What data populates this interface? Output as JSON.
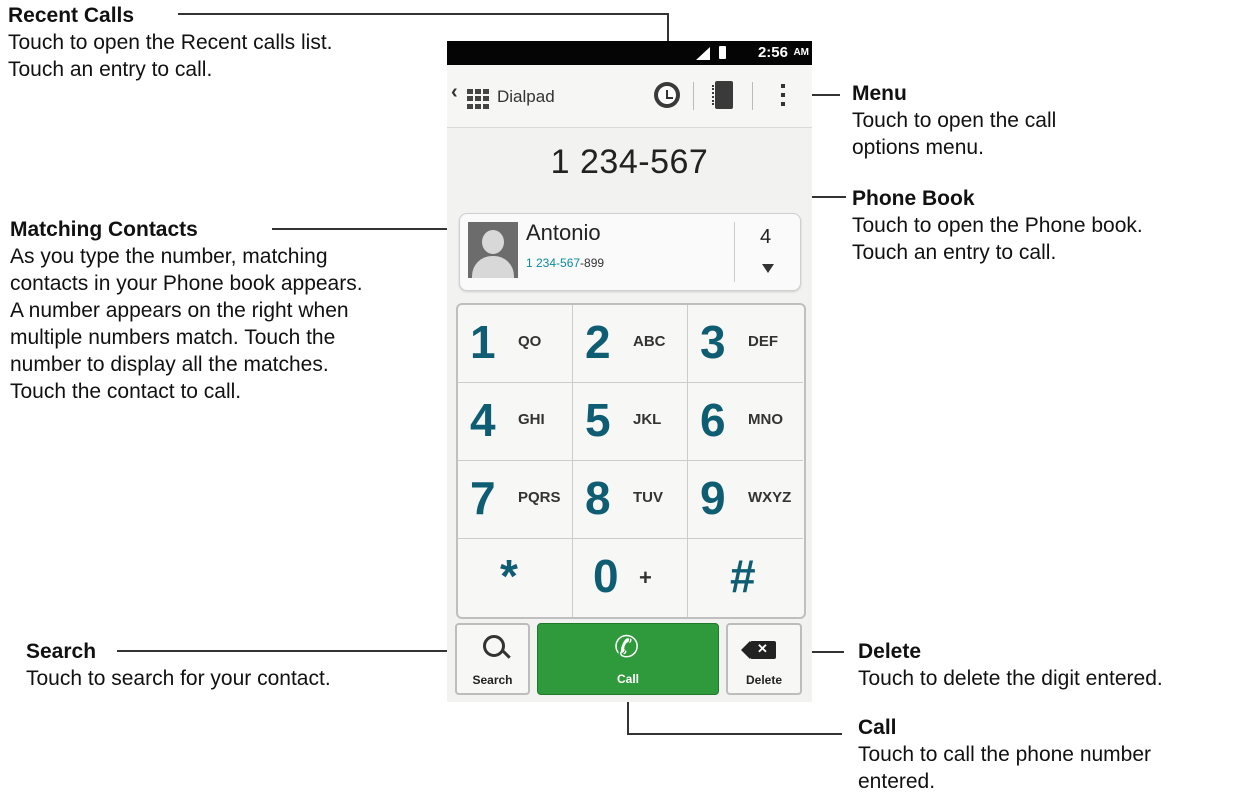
{
  "callouts": {
    "recent_calls": {
      "title": "Recent Calls",
      "desc": "Touch to open the Recent calls list.\nTouch an entry to call."
    },
    "menu": {
      "title": "Menu",
      "desc": "Touch to open the call\noptions menu."
    },
    "phone_book": {
      "title": "Phone Book",
      "desc": "Touch to open the Phone book.\nTouch an entry to call."
    },
    "matching_contacts": {
      "title": "Matching Contacts",
      "desc": "As you type the number, matching\ncontacts in your Phone book appears.\nA number appears on the right when\nmultiple numbers match. Touch the\nnumber to display all the matches.\nTouch the contact to call."
    },
    "search": {
      "title": "Search",
      "desc": "Touch to search for your contact."
    },
    "delete": {
      "title": "Delete",
      "desc": "Touch to delete the digit entered."
    },
    "call": {
      "title": "Call",
      "desc": "Touch to call the phone number\nentered."
    }
  },
  "phone": {
    "status": {
      "time": "2:56",
      "ampm": "AM",
      "icons": [
        "signal-icon",
        "battery-icon"
      ]
    },
    "action_bar": {
      "title": "Dialpad",
      "icons": [
        "back-icon",
        "grid-icon",
        "recent-calls-icon",
        "phone-book-icon",
        "menu-icon"
      ]
    },
    "number": "1 234-567",
    "contact": {
      "name": "Antonio",
      "number_match": "1 234-567",
      "number_rest": "-899",
      "match_count": "4"
    },
    "keys": [
      {
        "digit": "1",
        "letters": "QO"
      },
      {
        "digit": "2",
        "letters": "ABC"
      },
      {
        "digit": "3",
        "letters": "DEF"
      },
      {
        "digit": "4",
        "letters": "GHI"
      },
      {
        "digit": "5",
        "letters": "JKL"
      },
      {
        "digit": "6",
        "letters": "MNO"
      },
      {
        "digit": "7",
        "letters": "PQRS"
      },
      {
        "digit": "8",
        "letters": "TUV"
      },
      {
        "digit": "9",
        "letters": "WXYZ"
      },
      {
        "digit": "*",
        "letters": ""
      },
      {
        "digit": "0",
        "letters": "+"
      },
      {
        "digit": "#",
        "letters": ""
      }
    ],
    "buttons": {
      "search": "Search",
      "call": "Call",
      "delete": "Delete"
    },
    "colors": {
      "key_digit": "#0e5d73",
      "call_green": "#2e9a3b",
      "match_highlight": "#0b8aa0"
    }
  }
}
